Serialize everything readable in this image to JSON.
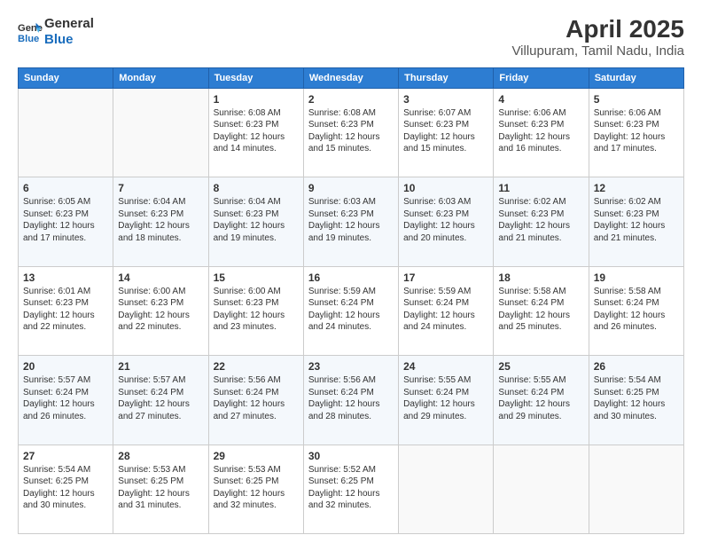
{
  "header": {
    "logo_line1": "General",
    "logo_line2": "Blue",
    "title": "April 2025",
    "subtitle": "Villupuram, Tamil Nadu, India"
  },
  "weekdays": [
    "Sunday",
    "Monday",
    "Tuesday",
    "Wednesday",
    "Thursday",
    "Friday",
    "Saturday"
  ],
  "weeks": [
    [
      {
        "day": "",
        "info": ""
      },
      {
        "day": "",
        "info": ""
      },
      {
        "day": "1",
        "info": "Sunrise: 6:08 AM\nSunset: 6:23 PM\nDaylight: 12 hours and 14 minutes."
      },
      {
        "day": "2",
        "info": "Sunrise: 6:08 AM\nSunset: 6:23 PM\nDaylight: 12 hours and 15 minutes."
      },
      {
        "day": "3",
        "info": "Sunrise: 6:07 AM\nSunset: 6:23 PM\nDaylight: 12 hours and 15 minutes."
      },
      {
        "day": "4",
        "info": "Sunrise: 6:06 AM\nSunset: 6:23 PM\nDaylight: 12 hours and 16 minutes."
      },
      {
        "day": "5",
        "info": "Sunrise: 6:06 AM\nSunset: 6:23 PM\nDaylight: 12 hours and 17 minutes."
      }
    ],
    [
      {
        "day": "6",
        "info": "Sunrise: 6:05 AM\nSunset: 6:23 PM\nDaylight: 12 hours and 17 minutes."
      },
      {
        "day": "7",
        "info": "Sunrise: 6:04 AM\nSunset: 6:23 PM\nDaylight: 12 hours and 18 minutes."
      },
      {
        "day": "8",
        "info": "Sunrise: 6:04 AM\nSunset: 6:23 PM\nDaylight: 12 hours and 19 minutes."
      },
      {
        "day": "9",
        "info": "Sunrise: 6:03 AM\nSunset: 6:23 PM\nDaylight: 12 hours and 19 minutes."
      },
      {
        "day": "10",
        "info": "Sunrise: 6:03 AM\nSunset: 6:23 PM\nDaylight: 12 hours and 20 minutes."
      },
      {
        "day": "11",
        "info": "Sunrise: 6:02 AM\nSunset: 6:23 PM\nDaylight: 12 hours and 21 minutes."
      },
      {
        "day": "12",
        "info": "Sunrise: 6:02 AM\nSunset: 6:23 PM\nDaylight: 12 hours and 21 minutes."
      }
    ],
    [
      {
        "day": "13",
        "info": "Sunrise: 6:01 AM\nSunset: 6:23 PM\nDaylight: 12 hours and 22 minutes."
      },
      {
        "day": "14",
        "info": "Sunrise: 6:00 AM\nSunset: 6:23 PM\nDaylight: 12 hours and 22 minutes."
      },
      {
        "day": "15",
        "info": "Sunrise: 6:00 AM\nSunset: 6:23 PM\nDaylight: 12 hours and 23 minutes."
      },
      {
        "day": "16",
        "info": "Sunrise: 5:59 AM\nSunset: 6:24 PM\nDaylight: 12 hours and 24 minutes."
      },
      {
        "day": "17",
        "info": "Sunrise: 5:59 AM\nSunset: 6:24 PM\nDaylight: 12 hours and 24 minutes."
      },
      {
        "day": "18",
        "info": "Sunrise: 5:58 AM\nSunset: 6:24 PM\nDaylight: 12 hours and 25 minutes."
      },
      {
        "day": "19",
        "info": "Sunrise: 5:58 AM\nSunset: 6:24 PM\nDaylight: 12 hours and 26 minutes."
      }
    ],
    [
      {
        "day": "20",
        "info": "Sunrise: 5:57 AM\nSunset: 6:24 PM\nDaylight: 12 hours and 26 minutes."
      },
      {
        "day": "21",
        "info": "Sunrise: 5:57 AM\nSunset: 6:24 PM\nDaylight: 12 hours and 27 minutes."
      },
      {
        "day": "22",
        "info": "Sunrise: 5:56 AM\nSunset: 6:24 PM\nDaylight: 12 hours and 27 minutes."
      },
      {
        "day": "23",
        "info": "Sunrise: 5:56 AM\nSunset: 6:24 PM\nDaylight: 12 hours and 28 minutes."
      },
      {
        "day": "24",
        "info": "Sunrise: 5:55 AM\nSunset: 6:24 PM\nDaylight: 12 hours and 29 minutes."
      },
      {
        "day": "25",
        "info": "Sunrise: 5:55 AM\nSunset: 6:24 PM\nDaylight: 12 hours and 29 minutes."
      },
      {
        "day": "26",
        "info": "Sunrise: 5:54 AM\nSunset: 6:25 PM\nDaylight: 12 hours and 30 minutes."
      }
    ],
    [
      {
        "day": "27",
        "info": "Sunrise: 5:54 AM\nSunset: 6:25 PM\nDaylight: 12 hours and 30 minutes."
      },
      {
        "day": "28",
        "info": "Sunrise: 5:53 AM\nSunset: 6:25 PM\nDaylight: 12 hours and 31 minutes."
      },
      {
        "day": "29",
        "info": "Sunrise: 5:53 AM\nSunset: 6:25 PM\nDaylight: 12 hours and 32 minutes."
      },
      {
        "day": "30",
        "info": "Sunrise: 5:52 AM\nSunset: 6:25 PM\nDaylight: 12 hours and 32 minutes."
      },
      {
        "day": "",
        "info": ""
      },
      {
        "day": "",
        "info": ""
      },
      {
        "day": "",
        "info": ""
      }
    ]
  ]
}
